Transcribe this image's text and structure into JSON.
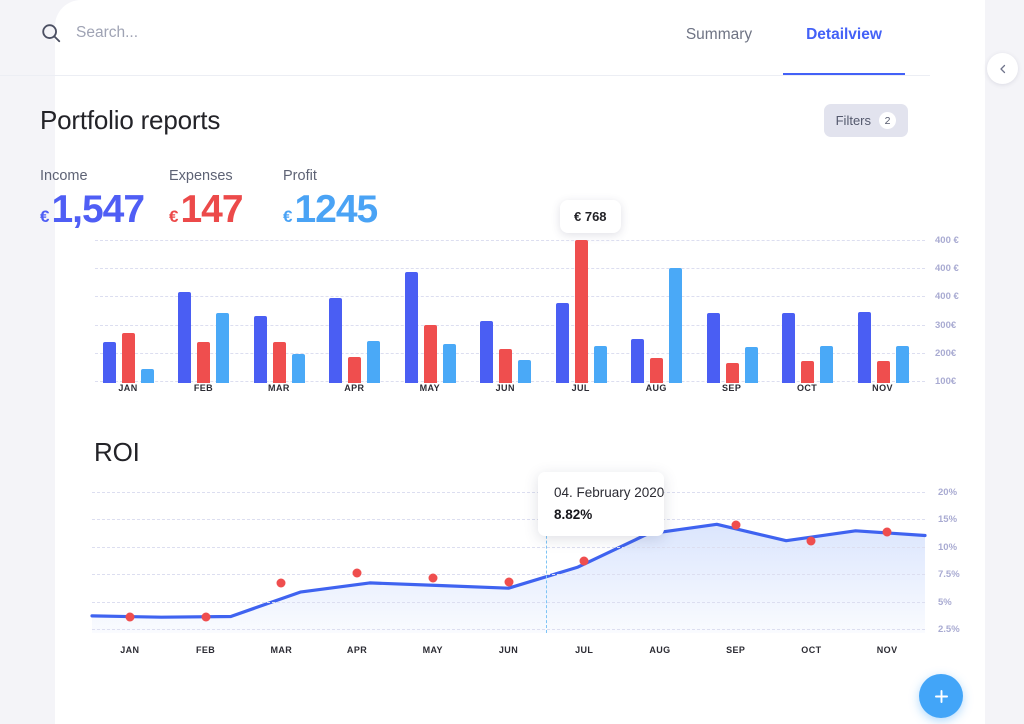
{
  "search": {
    "placeholder": "Search...",
    "value": "",
    "icon": "search-icon"
  },
  "tabs": [
    {
      "label": "Summary",
      "active": false
    },
    {
      "label": "Detailview",
      "active": true
    }
  ],
  "collapse_button": {
    "icon": "chevron-left-icon"
  },
  "header": {
    "title": "Portfolio reports",
    "filters_label": "Filters",
    "filters_count": "2"
  },
  "kpis": [
    {
      "label": "Income",
      "currency": "€",
      "value": "1,547",
      "color": "#4f5ef5"
    },
    {
      "label": "Expenses",
      "currency": "€",
      "value": "147",
      "color": "#ec4a4a"
    },
    {
      "label": "Profit",
      "currency": "€",
      "value": "1245",
      "color": "#4aa3f5"
    }
  ],
  "bar_tooltip": {
    "text": "€ 768"
  },
  "roi_section": {
    "title": "ROI"
  },
  "roi_tooltip": {
    "date": "04. February 2020",
    "value": "8.82%"
  },
  "fab": {
    "icon": "plus-icon",
    "color": "#42a5f8"
  },
  "chart_data": [
    {
      "type": "bar",
      "title": "Portfolio reports",
      "xlabel": "",
      "ylabel": "",
      "grid": true,
      "legend": "none",
      "categories": [
        "JAN",
        "FEB",
        "MAR",
        "APR",
        "MAY",
        "JUN",
        "JUL",
        "AUG",
        "SEP",
        "OCT",
        "NOV"
      ],
      "ytick_labels": [
        "400 €",
        "400 €",
        "400 €",
        "300€",
        "200€",
        "100€"
      ],
      "ytick_values": [
        400,
        400,
        400,
        300,
        200,
        100
      ],
      "ylim": [
        0,
        450
      ],
      "series": [
        {
          "name": "Income",
          "color": "#4a5ef3",
          "values": [
            175,
            390,
            285,
            365,
            475,
            265,
            340,
            190,
            300,
            300,
            305
          ]
        },
        {
          "name": "Expenses",
          "color": "#ef4e4e",
          "values": [
            215,
            175,
            175,
            110,
            250,
            145,
            610,
            105,
            85,
            95,
            95
          ]
        },
        {
          "name": "Profit",
          "color": "#4aa9f7",
          "values": [
            60,
            300,
            125,
            180,
            165,
            100,
            160,
            490,
            155,
            160,
            160
          ]
        }
      ]
    },
    {
      "type": "area",
      "title": "ROI",
      "xlabel": "",
      "ylabel": "",
      "grid": true,
      "legend": "none",
      "categories": [
        "JAN",
        "FEB",
        "MAR",
        "APR",
        "MAY",
        "JUN",
        "JUL",
        "AUG",
        "SEP",
        "OCT",
        "NOV"
      ],
      "ytick_labels": [
        "20%",
        "15%",
        "10%",
        "7.5%",
        "5%",
        "2.5%"
      ],
      "ytick_values": [
        20,
        15,
        10,
        7.5,
        5,
        2.5
      ],
      "ylim": [
        0,
        22
      ],
      "series": [
        {
          "name": "ROI",
          "color": "#3f63f0",
          "values": [
            2.6,
            2.4,
            2.5,
            6.2,
            7.6,
            7.2,
            6.8,
            10.0,
            15.0,
            16.5,
            14.0,
            15.5,
            14.8
          ]
        }
      ],
      "highlight": {
        "label": "04. February 2020",
        "value": "8.82%",
        "x_index": 5.5,
        "y": 19.6
      },
      "marker_points": [
        {
          "category": "JAN",
          "value": 2.4
        },
        {
          "category": "FEB",
          "value": 2.5
        },
        {
          "category": "MAR",
          "value": 7.6
        },
        {
          "category": "APR",
          "value": 9.1
        },
        {
          "category": "MAY",
          "value": 8.4
        },
        {
          "category": "JUN",
          "value": 7.8
        },
        {
          "category": "JUL",
          "value": 11.0
        },
        {
          "category": "SEP",
          "value": 16.4
        },
        {
          "category": "OCT",
          "value": 13.9
        },
        {
          "category": "NOV",
          "value": 15.4
        }
      ]
    }
  ]
}
